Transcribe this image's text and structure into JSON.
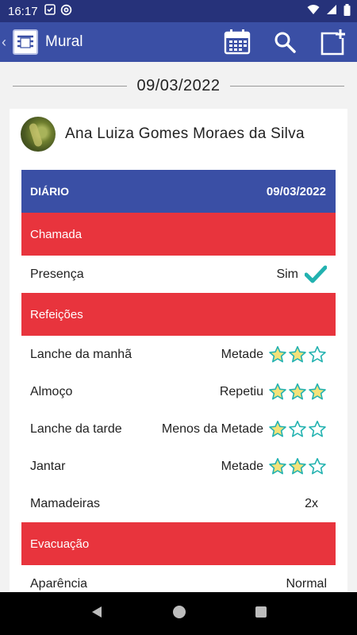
{
  "status_bar": {
    "time": "16:17"
  },
  "app_bar": {
    "title": "Mural"
  },
  "date_separator": "09/03/2022",
  "post": {
    "author": "Ana Luiza Gomes Moraes da Silva",
    "diary": {
      "header_label": "DIÁRIO",
      "header_date": "09/03/2022",
      "sections": {
        "chamada": {
          "title": "Chamada",
          "presenca_label": "Presença",
          "presenca_value": "Sim"
        },
        "refeicoes": {
          "title": "Refeições",
          "items": [
            {
              "label": "Lanche da manhã",
              "value": "Metade",
              "stars": 2,
              "max_stars": 3
            },
            {
              "label": "Almoço",
              "value": "Repetiu",
              "stars": 3,
              "max_stars": 3
            },
            {
              "label": "Lanche da tarde",
              "value": "Menos da Metade",
              "stars": 1,
              "max_stars": 3
            },
            {
              "label": "Jantar",
              "value": "Metade",
              "stars": 2,
              "max_stars": 3
            }
          ],
          "mamadeiras_label": "Mamadeiras",
          "mamadeiras_value": "2x"
        },
        "evacuacao": {
          "title": "Evacuação",
          "aparencia_label": "Aparência",
          "aparencia_value": "Normal"
        }
      }
    }
  },
  "colors": {
    "primary": "#3a4fa5",
    "status_bar": "#26327a",
    "section_red": "#e8343d",
    "star_fill": "#f3e27a",
    "star_stroke": "#22b2b0",
    "check": "#22b2b0"
  },
  "icons": {
    "calendar": "calendar-icon",
    "search": "search-icon",
    "new_post": "new-post-icon"
  }
}
